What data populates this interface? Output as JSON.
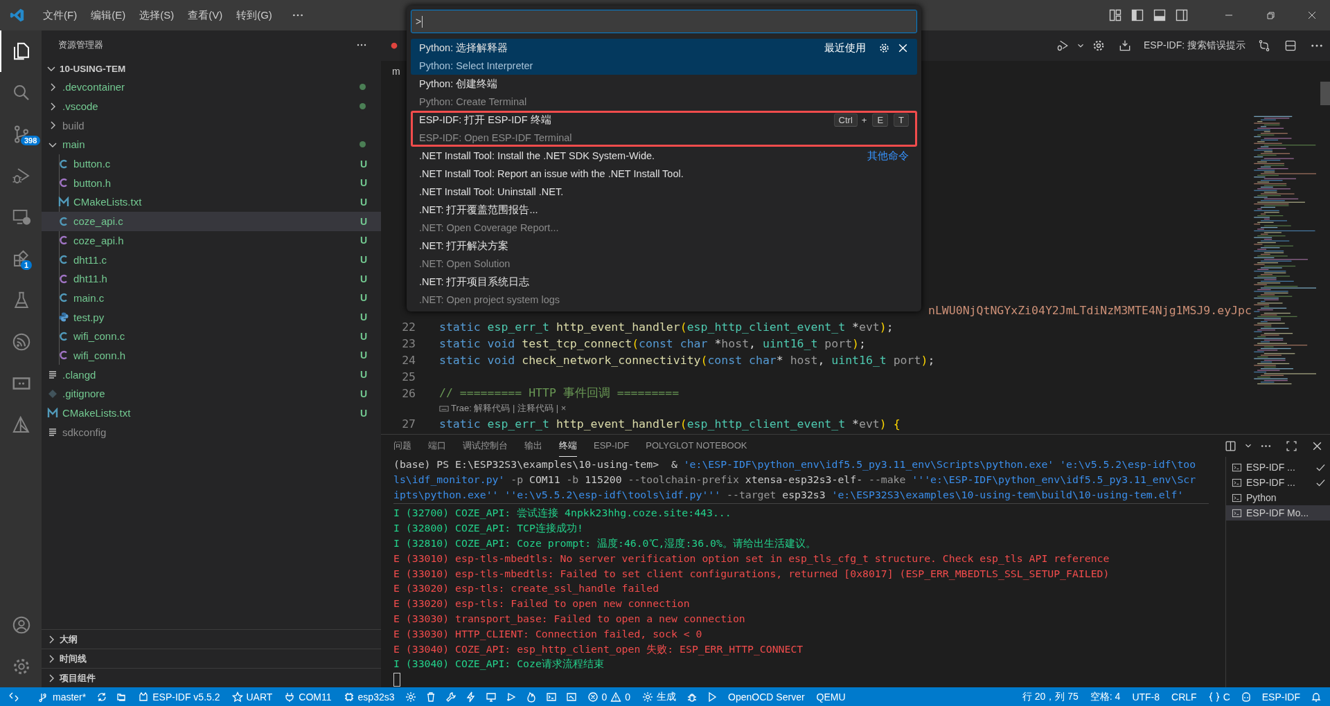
{
  "title_bar": {
    "menus": [
      "文件(F)",
      "编辑(E)",
      "选择(S)",
      "查看(V)",
      "转到(G)"
    ]
  },
  "activity_bar": {
    "items": [
      {
        "kind": "explorer",
        "selected": true
      },
      {
        "kind": "search",
        "selected": false
      },
      {
        "kind": "scm",
        "selected": false,
        "badge": "398"
      },
      {
        "kind": "debug",
        "selected": false
      },
      {
        "kind": "remote",
        "selected": false
      },
      {
        "kind": "extensions",
        "selected": false,
        "badge": "1"
      },
      {
        "kind": "testing",
        "selected": false
      },
      {
        "kind": "esp",
        "selected": false
      },
      {
        "kind": "serial",
        "selected": false
      },
      {
        "kind": "idf",
        "selected": false
      }
    ],
    "bottom": [
      {
        "kind": "account",
        "selected": false
      },
      {
        "kind": "manage",
        "selected": false
      }
    ]
  },
  "explorer": {
    "title": "资源管理器",
    "root": {
      "label": "10-USING-TEM",
      "expanded": true,
      "children": [
        {
          "label": ".devcontainer",
          "kind": "folder",
          "expanded": false,
          "modified": true,
          "ignored": false,
          "selected": false
        },
        {
          "label": ".vscode",
          "kind": "folder",
          "expanded": false,
          "modified": true,
          "ignored": false,
          "selected": false
        },
        {
          "label": "build",
          "kind": "folder",
          "expanded": false,
          "modified": false,
          "ignored": true,
          "selected": false
        },
        {
          "label": "main",
          "kind": "folder",
          "expanded": true,
          "modified": true,
          "ignored": false,
          "selected": false,
          "children": [
            {
              "label": "button.c",
              "kind": "c",
              "status": "U",
              "ignored": false,
              "selected": false
            },
            {
              "label": "button.h",
              "kind": "h",
              "status": "U",
              "ignored": false,
              "selected": false
            },
            {
              "label": "CMakeLists.txt",
              "kind": "cmake",
              "status": "U",
              "ignored": false,
              "selected": false
            },
            {
              "label": "coze_api.c",
              "kind": "c",
              "status": "U",
              "ignored": false,
              "selected": true
            },
            {
              "label": "coze_api.h",
              "kind": "h",
              "status": "U",
              "ignored": false,
              "selected": false
            },
            {
              "label": "dht11.c",
              "kind": "c",
              "status": "U",
              "ignored": false,
              "selected": false
            },
            {
              "label": "dht11.h",
              "kind": "h",
              "status": "U",
              "ignored": false,
              "selected": false
            },
            {
              "label": "main.c",
              "kind": "c",
              "status": "U",
              "ignored": false,
              "selected": false
            },
            {
              "label": "test.py",
              "kind": "python",
              "status": "U",
              "ignored": false,
              "selected": false
            },
            {
              "label": "wifi_conn.c",
              "kind": "c",
              "status": "U",
              "ignored": false,
              "selected": false
            },
            {
              "label": "wifi_conn.h",
              "kind": "h",
              "status": "U",
              "ignored": false,
              "selected": false
            }
          ]
        },
        {
          "label": ".clangd",
          "kind": "text",
          "status": "U",
          "ignored": false,
          "selected": false
        },
        {
          "label": ".gitignore",
          "kind": "git",
          "status": "U",
          "ignored": false,
          "selected": false
        },
        {
          "label": "CMakeLists.txt",
          "kind": "cmake",
          "status": "U",
          "ignored": false,
          "selected": false
        },
        {
          "label": "sdkconfig",
          "kind": "text",
          "ignored": true,
          "selected": false
        }
      ]
    },
    "sections": [
      {
        "label": "大纲",
        "expanded": false
      },
      {
        "label": "时间线",
        "expanded": false
      },
      {
        "label": "项目组件",
        "expanded": false
      }
    ]
  },
  "editor": {
    "breadcrumb": "m",
    "toolbar_label": "ESP-IDF:  搜索错误提示",
    "partial_line": "nLWU0NjQtNGYxZi04Y2JmLTdiNzM3MTE4Njg1MSJ9.eyJpc",
    "lines": [
      {
        "number": "22",
        "segments": [
          {
            "kind": "kw",
            "text": "static "
          },
          {
            "kind": "type",
            "text": "esp_err_t "
          },
          {
            "kind": "fn",
            "text": "http_event_handler"
          },
          {
            "kind": "br",
            "text": "("
          },
          {
            "kind": "type",
            "text": "esp_http_client_event_t"
          },
          {
            "kind": "plain",
            "text": " *"
          },
          {
            "kind": "dim",
            "text": "evt"
          },
          {
            "kind": "br",
            "text": ")"
          },
          {
            "kind": "plain",
            "text": ";"
          }
        ]
      },
      {
        "number": "23",
        "segments": [
          {
            "kind": "kw",
            "text": "static void "
          },
          {
            "kind": "fn",
            "text": "test_tcp_connect"
          },
          {
            "kind": "br",
            "text": "("
          },
          {
            "kind": "kw",
            "text": "const char "
          },
          {
            "kind": "plain",
            "text": "*"
          },
          {
            "kind": "dim",
            "text": "host"
          },
          {
            "kind": "plain",
            "text": ", "
          },
          {
            "kind": "type",
            "text": "uint16_t "
          },
          {
            "kind": "dim",
            "text": "port"
          },
          {
            "kind": "br",
            "text": ")"
          },
          {
            "kind": "plain",
            "text": ";"
          }
        ]
      },
      {
        "number": "24",
        "segments": [
          {
            "kind": "kw",
            "text": "static void "
          },
          {
            "kind": "fn",
            "text": "check_network_connectivity"
          },
          {
            "kind": "br",
            "text": "("
          },
          {
            "kind": "kw",
            "text": "const char"
          },
          {
            "kind": "plain",
            "text": "* "
          },
          {
            "kind": "dim",
            "text": "host"
          },
          {
            "kind": "plain",
            "text": ", "
          },
          {
            "kind": "type",
            "text": "uint16_t "
          },
          {
            "kind": "dim",
            "text": "port"
          },
          {
            "kind": "br",
            "text": ")"
          },
          {
            "kind": "plain",
            "text": ";"
          }
        ]
      },
      {
        "number": "25"
      },
      {
        "number": "26",
        "segments": [
          {
            "kind": "comment",
            "text": "// ========= HTTP 事件回调 ========="
          }
        ],
        "codelens": "Trae: 解释代码 | 注释代码 | ×"
      },
      {
        "number": "27",
        "segments": [
          {
            "kind": "kw",
            "text": "static "
          },
          {
            "kind": "type",
            "text": "esp_err_t "
          },
          {
            "kind": "fn",
            "text": "http_event_handler"
          },
          {
            "kind": "br",
            "text": "("
          },
          {
            "kind": "type",
            "text": "esp_http_client_event_t"
          },
          {
            "kind": "plain",
            "text": " *"
          },
          {
            "kind": "dim",
            "text": "evt"
          },
          {
            "kind": "br",
            "text": ") {"
          }
        ]
      }
    ]
  },
  "command_palette": {
    "input": ">",
    "items": [
      {
        "label": "Python: 选择解释器",
        "detail": "Python: Select Interpreter",
        "selected": true,
        "outlined": false,
        "tag": "最近使用"
      },
      {
        "label": "Python: 创建终端",
        "detail": "Python: Create Terminal",
        "selected": false,
        "outlined": false
      },
      {
        "label": "ESP-IDF: 打开 ESP-IDF 终端",
        "detail": "ESP-IDF: Open ESP-IDF Terminal",
        "selected": false,
        "outlined": true,
        "keybinding": [
          {
            "kind": "key",
            "text": "Ctrl"
          },
          {
            "kind": "plus",
            "text": "+"
          },
          {
            "kind": "key",
            "text": "E"
          },
          {
            "kind": "key",
            "text": "T"
          }
        ]
      },
      {
        "label": ".NET Install Tool: Install the .NET SDK System-Wide.",
        "selected": false,
        "outlined": false,
        "group": "其他命令"
      },
      {
        "label": ".NET Install Tool: Report an issue with the .NET Install Tool.",
        "selected": false,
        "outlined": false
      },
      {
        "label": ".NET Install Tool: Uninstall .NET.",
        "selected": false,
        "outlined": false
      },
      {
        "label": ".NET: 打开覆盖范围报告...",
        "detail": ".NET: Open Coverage Report...",
        "selected": false,
        "outlined": false
      },
      {
        "label": ".NET: 打开解决方案",
        "detail": ".NET: Open Solution",
        "selected": false,
        "outlined": false
      },
      {
        "label": ".NET: 打开项目系统日志",
        "detail": ".NET: Open project system logs",
        "selected": false,
        "outlined": false
      }
    ]
  },
  "panel": {
    "tabs": [
      {
        "label": "问题",
        "selected": false
      },
      {
        "label": "端口",
        "selected": false
      },
      {
        "label": "调试控制台",
        "selected": false
      },
      {
        "label": "输出",
        "selected": false
      },
      {
        "label": "终端",
        "selected": true
      },
      {
        "label": "ESP-IDF",
        "selected": false
      },
      {
        "label": "POLYGLOT NOTEBOOK",
        "selected": false
      }
    ],
    "command_lines": [
      [
        {
          "kind": "plain",
          "text": "(base) PS E:\\ESP32S3\\examples\\10-using-tem>  & "
        },
        {
          "kind": "str",
          "text": "'e:\\ESP-IDF\\python_env\\idf5.5_py3.11_env\\Scripts\\python.exe' 'e:\\v5.5.2\\esp-idf\\too"
        }
      ],
      [
        {
          "kind": "str",
          "text": "ls\\idf_monitor.py'"
        },
        {
          "kind": "arg",
          "text": " -p "
        },
        {
          "kind": "plain",
          "text": "COM11"
        },
        {
          "kind": "arg",
          "text": " -b "
        },
        {
          "kind": "plain",
          "text": "115200"
        },
        {
          "kind": "arg",
          "text": " --toolchain-prefix "
        },
        {
          "kind": "plain",
          "text": "xtensa-esp32s3-elf-"
        },
        {
          "kind": "arg",
          "text": " --make "
        },
        {
          "kind": "str",
          "text": "'''e:\\ESP-IDF\\python_env\\idf5.5_py3.11_env\\Scr"
        }
      ],
      [
        {
          "kind": "str",
          "text": "ipts\\python.exe'' ''e:\\v5.5.2\\esp-idf\\tools\\idf.py'''"
        },
        {
          "kind": "arg",
          "text": " --target "
        },
        {
          "kind": "plain",
          "text": "esp32s3 "
        },
        {
          "kind": "str",
          "text": "'e:\\ESP32S3\\examples\\10-using-tem\\build\\10-using-tem.elf'"
        }
      ]
    ],
    "log": [
      {
        "kind": "info",
        "text": "I (32700) COZE_API: 尝试连接 4npkk23hhg.coze.site:443..."
      },
      {
        "kind": "info",
        "text": "I (32800) COZE_API: TCP连接成功!"
      },
      {
        "kind": "info",
        "text": "I (32810) COZE_API: Coze prompt: 温度:46.0℃,湿度:36.0%。请给出生活建议。"
      },
      {
        "kind": "error",
        "text": "E (33010) esp-tls-mbedtls: No server verification option set in esp_tls_cfg_t structure. Check esp_tls API reference"
      },
      {
        "kind": "error",
        "text": "E (33010) esp-tls-mbedtls: Failed to set client configurations, returned [0x8017] (ESP_ERR_MBEDTLS_SSL_SETUP_FAILED)"
      },
      {
        "kind": "error",
        "text": "E (33020) esp-tls: create_ssl_handle failed"
      },
      {
        "kind": "error",
        "text": "E (33020) esp-tls: Failed to open new connection"
      },
      {
        "kind": "error",
        "text": "E (33030) transport_base: Failed to open a new connection"
      },
      {
        "kind": "error",
        "text": "E (33030) HTTP_CLIENT: Connection failed, sock < 0"
      },
      {
        "kind": "error",
        "text": "E (33040) COZE_API: esp_http_client_open 失败: ESP_ERR_HTTP_CONNECT"
      },
      {
        "kind": "info",
        "text": "I (33040) COZE_API: Coze请求流程结束"
      }
    ],
    "terminals": [
      {
        "label": "ESP-IDF ...",
        "selected": false,
        "checked": true
      },
      {
        "label": "ESP-IDF ...",
        "selected": false,
        "checked": true
      },
      {
        "label": "Python",
        "selected": false,
        "checked": false
      },
      {
        "label": "ESP-IDF Mo...",
        "selected": true,
        "checked": false
      }
    ]
  },
  "status_bar": {
    "branch": "master*",
    "idf_version": "ESP-IDF v5.5.2",
    "connection": "UART",
    "port": "COM11",
    "target": "esp32s3",
    "errors": "0",
    "warnings": "0",
    "build": "生成",
    "openocd": "OpenOCD Server",
    "qemu": "QEMU",
    "cursor": "行 20，列 75",
    "indent": "空格: 4",
    "encoding": "UTF-8",
    "eol": "CRLF",
    "language": "C",
    "idf": "ESP-IDF"
  }
}
